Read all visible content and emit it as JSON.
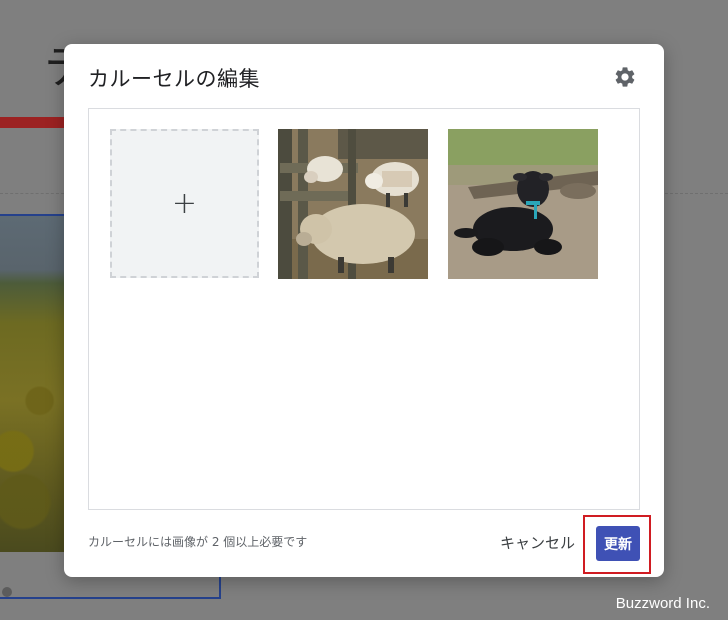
{
  "background": {
    "title_glyph": "テ"
  },
  "dialog": {
    "title": "カルーセルの編集",
    "settings_icon": "gear-icon",
    "add_tile_symbol": "+",
    "images": [
      {
        "icon": "sheep-photo"
      },
      {
        "icon": "black-lamb-photo"
      }
    ],
    "footer_note": "カルーセルには画像が 2 個以上必要です",
    "cancel_label": "キャンセル",
    "update_label": "更新"
  },
  "watermark": "Buzzword Inc.",
  "colors": {
    "overlay": "#7f7f7f",
    "primary_button": "#3f51b5",
    "highlight": "#d01c22"
  }
}
